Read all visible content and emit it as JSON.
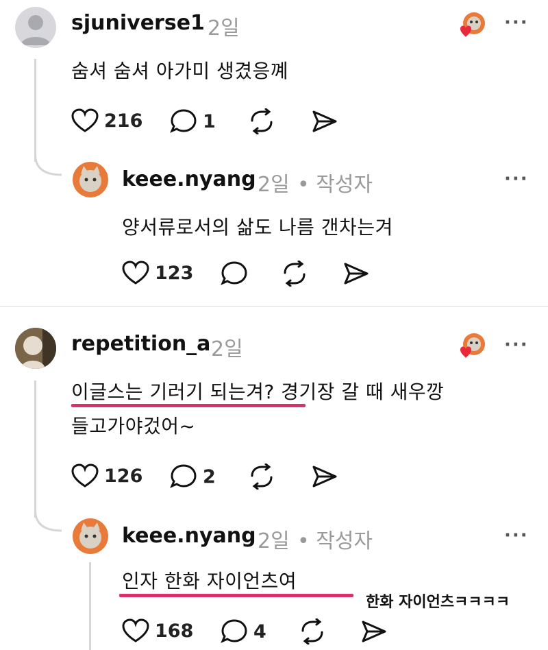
{
  "threads": [
    {
      "user": "sjuniverse1",
      "time": "2일",
      "text": "숨셔 숨셔 아가미 생겼응꼐",
      "likes": "216",
      "replies": "1",
      "reply": {
        "user": "keee.nyang",
        "time": "2일",
        "author_tag": "• 작성자",
        "text": "양서류로서의 삶도 나름 갠차는겨",
        "likes": "123"
      }
    },
    {
      "user": "repetition_a",
      "time": "2일",
      "text_line1": "이글스는 기러기 되는겨? 경기장 갈 때 새우깡",
      "text_line2": "들고가야겄어~",
      "likes": "126",
      "replies": "2",
      "reply": {
        "user": "keee.nyang",
        "time": "2일",
        "author_tag": "• 작성자",
        "text": "인자 한화 자이언츠여",
        "likes": "168",
        "replies": "4"
      }
    }
  ],
  "more_label": "···",
  "annotation": "한화 자이언츠ㅋㅋㅋㅋ",
  "colors": {
    "highlight": "#d6336c",
    "muted": "#9a9a9a"
  }
}
